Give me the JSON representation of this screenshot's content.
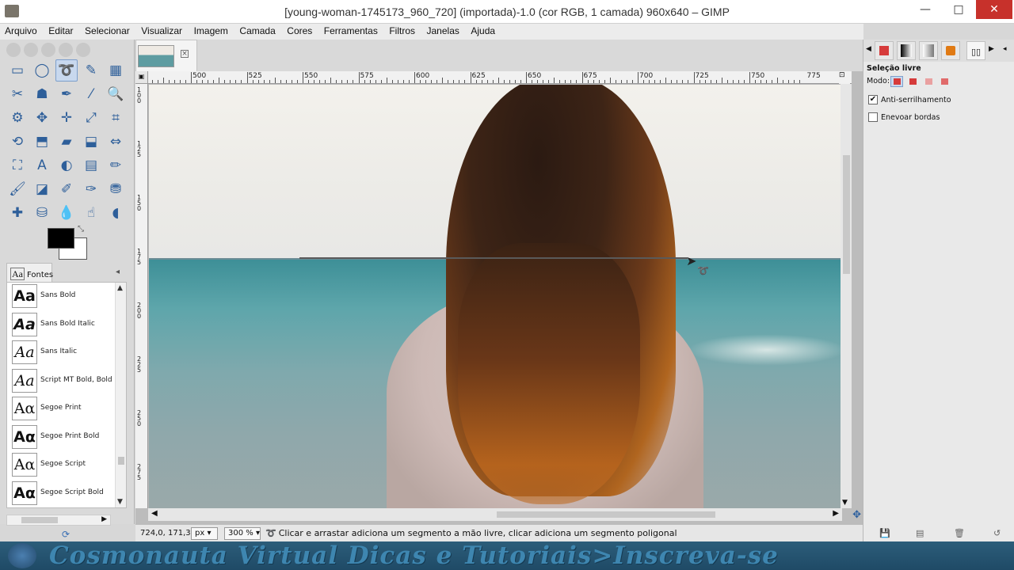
{
  "window": {
    "title": "[young-woman-1745173_960_720] (importada)-1.0 (cor RGB, 1 camada) 960x640 – GIMP",
    "minimize": "—",
    "maximize": "□",
    "close": "✕"
  },
  "menu": [
    "Arquivo",
    "Editar",
    "Selecionar",
    "Visualizar",
    "Imagem",
    "Camada",
    "Cores",
    "Ferramentas",
    "Filtros",
    "Janelas",
    "Ajuda"
  ],
  "toolbox": {
    "tools": [
      {
        "name": "rect-select-icon",
        "glyph": "▭"
      },
      {
        "name": "ellipse-select-icon",
        "glyph": "◯"
      },
      {
        "name": "lasso-select-icon",
        "glyph": "➰",
        "active": true
      },
      {
        "name": "fuzzy-select-icon",
        "glyph": "✎"
      },
      {
        "name": "color-select-icon",
        "glyph": "▦"
      },
      {
        "name": "scissors-select-icon",
        "glyph": "✂"
      },
      {
        "name": "foreground-select-icon",
        "glyph": "☗"
      },
      {
        "name": "paths-icon",
        "glyph": "✒"
      },
      {
        "name": "color-picker-icon",
        "glyph": "⁄"
      },
      {
        "name": "zoom-icon",
        "glyph": "🔍"
      },
      {
        "name": "measure-icon",
        "glyph": "⚙"
      },
      {
        "name": "move-icon",
        "glyph": "✥"
      },
      {
        "name": "align-icon",
        "glyph": "✛"
      },
      {
        "name": "transform-icon",
        "glyph": "⤢"
      },
      {
        "name": "crop-icon",
        "glyph": "⌗"
      },
      {
        "name": "rotate-icon",
        "glyph": "⟲"
      },
      {
        "name": "scale-icon",
        "glyph": "⬒"
      },
      {
        "name": "shear-icon",
        "glyph": "▰"
      },
      {
        "name": "perspective-icon",
        "glyph": "⬓"
      },
      {
        "name": "flip-icon",
        "glyph": "⇔"
      },
      {
        "name": "cage-icon",
        "glyph": "⛶"
      },
      {
        "name": "text-icon",
        "glyph": "A"
      },
      {
        "name": "bucket-fill-icon",
        "glyph": "◐"
      },
      {
        "name": "blend-icon",
        "glyph": "▤"
      },
      {
        "name": "pencil-icon",
        "glyph": "✏"
      },
      {
        "name": "paintbrush-icon",
        "glyph": "🖌"
      },
      {
        "name": "eraser-icon",
        "glyph": "◪"
      },
      {
        "name": "airbrush-icon",
        "glyph": "✐"
      },
      {
        "name": "ink-icon",
        "glyph": "✑"
      },
      {
        "name": "clone-icon",
        "glyph": "⛃"
      },
      {
        "name": "heal-icon",
        "glyph": "✚"
      },
      {
        "name": "perspective-clone-icon",
        "glyph": "⛁"
      },
      {
        "name": "blur-icon",
        "glyph": "💧"
      },
      {
        "name": "smudge-icon",
        "glyph": "☝"
      },
      {
        "name": "dodge-burn-icon",
        "glyph": "◖"
      }
    ],
    "fonts_tab": "Fontes",
    "fonts": [
      {
        "preview": "Aa",
        "style": "bold",
        "name": "Sans Bold"
      },
      {
        "preview": "Aa",
        "style": "bold italic",
        "name": "Sans Bold Italic"
      },
      {
        "preview": "Aa",
        "style": "italic",
        "name": "Sans Italic"
      },
      {
        "preview": "Aa",
        "style": "italic",
        "name": "Script MT Bold, Bold"
      },
      {
        "preview": "Aα",
        "style": "",
        "name": "Segoe Print"
      },
      {
        "preview": "Aα",
        "style": "bold",
        "name": "Segoe Print Bold"
      },
      {
        "preview": "Aα",
        "style": "",
        "name": "Segoe Script"
      },
      {
        "preview": "Aα",
        "style": "bold",
        "name": "Segoe Script Bold"
      }
    ]
  },
  "canvas": {
    "ruler_top_labels": [
      "500",
      "525",
      "550",
      "575",
      "600",
      "625",
      "650",
      "675",
      "700",
      "725",
      "750",
      "775"
    ],
    "ruler_left_labels": [
      "100",
      "125",
      "150",
      "175",
      "200",
      "225",
      "250",
      "275"
    ]
  },
  "status": {
    "coords": "724,0, 171,3",
    "unit": "px",
    "zoom": "300 %",
    "message": "Clicar e arrastar adiciona um segmento a mão livre, clicar adiciona um segmento poligonal"
  },
  "tool_options": {
    "title": "Seleção livre",
    "mode_label": "Modo:",
    "antialias_label": "Anti-serrilhamento",
    "antialias_checked": true,
    "feather_label": "Enevoar bordas",
    "feather_checked": false
  },
  "watermark": {
    "text": "Cosmonauta Virtual Dicas e Tutoriais>Inscreva-se"
  }
}
